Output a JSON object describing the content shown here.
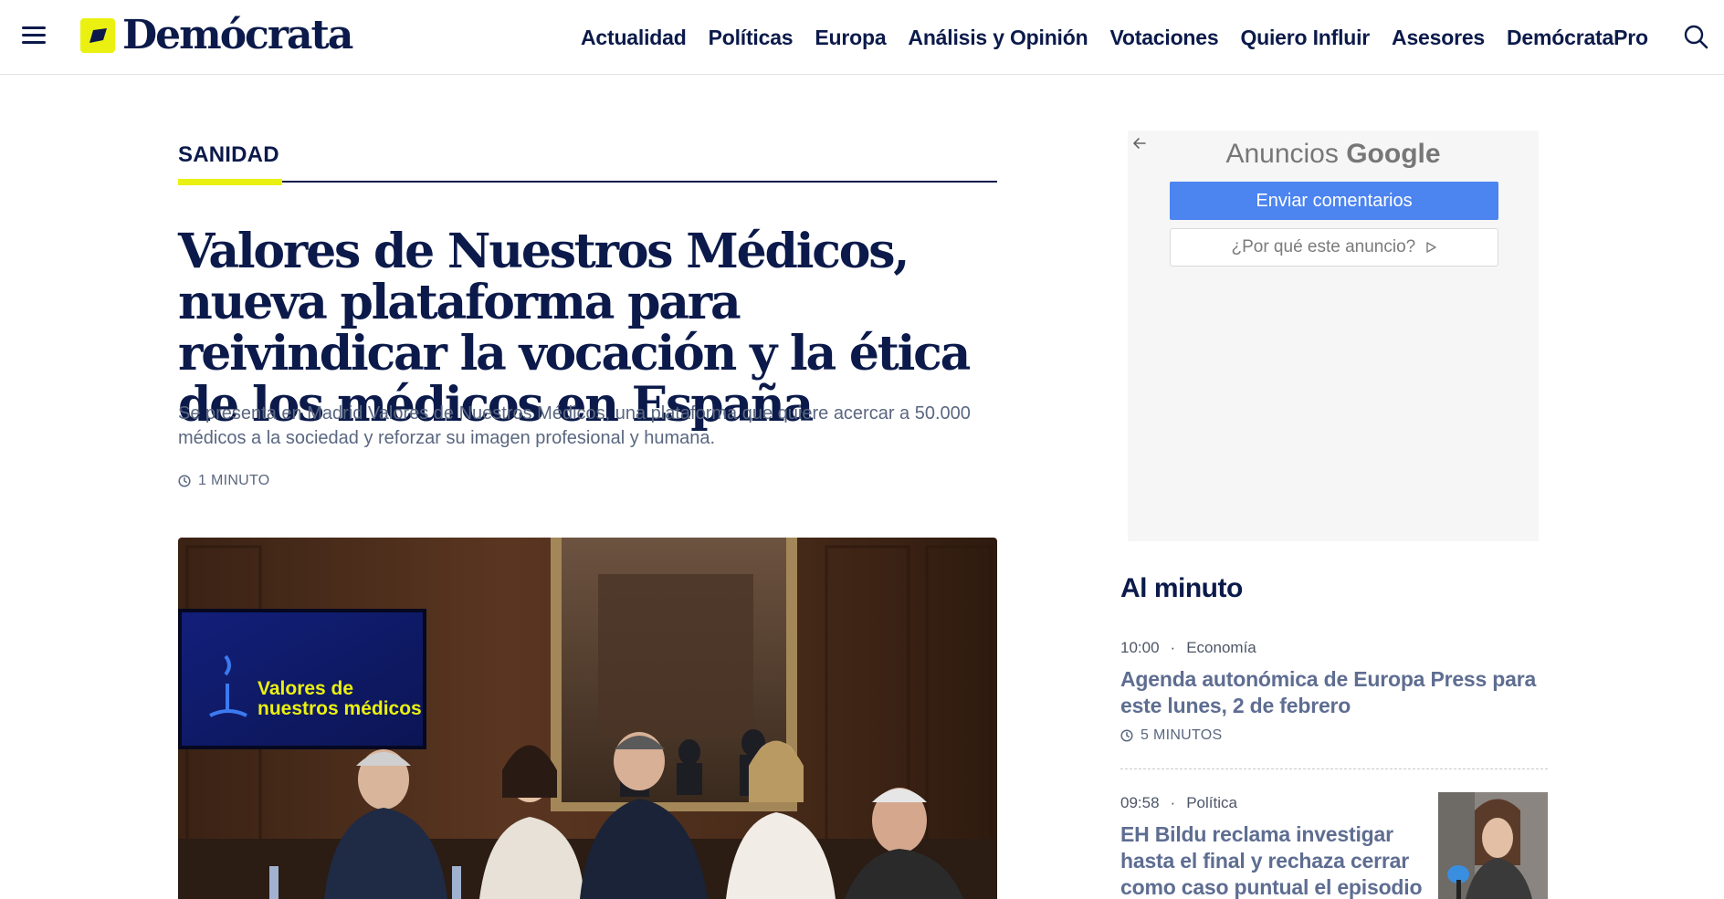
{
  "site": {
    "logo_text": "Demócrata",
    "nav": [
      "Actualidad",
      "Políticas",
      "Europa",
      "Análisis y Opinión",
      "Votaciones",
      "Quiero Influir",
      "Asesores",
      "DemócrataPro"
    ]
  },
  "article": {
    "section": "SANIDAD",
    "headline": "Valores de Nuestros Médicos, nueva plataforma para reivindicar la vocación y la ética de los médicos en España",
    "subhead": "Se presenta en Madrid Valores de Nuestros Médicos, una plataforma que quiere acercar a 50.000 médicos a la sociedad y reforzar su imagen profesional y humana.",
    "read_time": "1 MINUTO",
    "photo_screen_text_1": "Valores de",
    "photo_screen_text_2": "nuestros médicos"
  },
  "ad": {
    "title_prefix": "Anuncios",
    "title_brand": "Google",
    "feedback_button": "Enviar comentarios",
    "why_button": "¿Por qué este anuncio?"
  },
  "sidebar": {
    "title": "Al minuto",
    "items": [
      {
        "time": "10:00",
        "category": "Economía",
        "headline": "Agenda autonómica de Europa Press para este lunes, 2 de febrero",
        "read_time": "5 MINUTOS"
      },
      {
        "time": "09:58",
        "category": "Política",
        "headline": "EH Bildu reclama investigar hasta el final y rechaza cerrar como caso puntual el episodio"
      }
    ]
  },
  "colors": {
    "brand_navy": "#0b1a4a",
    "brand_yellow": "#eaf110",
    "ad_blue": "#4c84f0",
    "muted_headline": "#5e6d91"
  },
  "icons": [
    "menu-icon",
    "logo-mark-icon",
    "search-icon",
    "clock-icon",
    "back-arrow-icon",
    "ad-choices-icon"
  ]
}
